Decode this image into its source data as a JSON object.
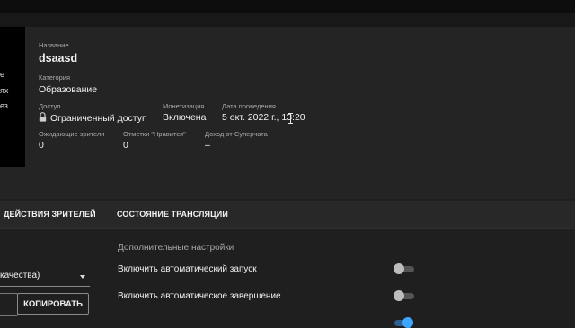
{
  "thumbnail": {
    "fragments": [
      "е",
      "ях",
      "ез"
    ]
  },
  "details": {
    "title_label": "Название",
    "title_value": "dsaasd",
    "category_label": "Категория",
    "category_value": "Образование",
    "access_label": "Доступ",
    "access_value": "Ограниченный доступ",
    "monetization_label": "Монетизация",
    "monetization_value": "Включена",
    "date_label": "Дата проведения",
    "date_value": "5 окт. 2022 г., 13:20",
    "waiting_label": "Ожидающие зрители",
    "waiting_value": "0",
    "likes_label": "Отметки \"Нравится\"",
    "likes_value": "0",
    "superchat_label": "Доход от Суперчата",
    "superchat_value": "–"
  },
  "tabs": {
    "viewer_actions": "ДЕЙСТВИЯ ЗРИТЕЛЕЙ",
    "stream_status": "СОСТОЯНИЕ ТРАНСЛЯЦИИ"
  },
  "settings": {
    "section_title": "Дополнительные настройки",
    "auto_start_label": "Включить автоматический запуск",
    "auto_start_on": false,
    "auto_stop_label": "Включить автоматическое завершение",
    "auto_stop_on": false,
    "third_on": true
  },
  "stream": {
    "quality_select_text": "качества)",
    "copy_button": "КОПИРОВАТЬ"
  },
  "colors": {
    "background": "#1f1f1f",
    "panel": "#242424",
    "accent": "#3ea6ff"
  }
}
